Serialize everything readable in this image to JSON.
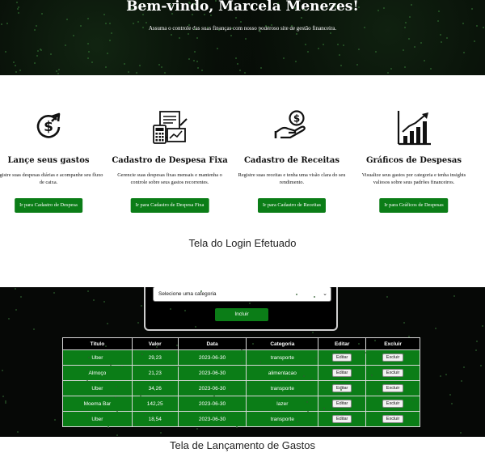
{
  "hero": {
    "title": "Bem-vindo, Marcela Menezes!",
    "subtitle": "Assuma o controle das suas finanças com nosso poderoso site de gestão financeira."
  },
  "cards": [
    {
      "icon": "dollar-growth-icon",
      "title": "Lançe seus gastos",
      "description": "Registre suas despesas diárias e acompanhe seu fluxo de caixa.",
      "button": "Ir para Cadastro de Despesa"
    },
    {
      "icon": "invoice-calculator-icon",
      "title": "Cadastro de Despesa Fixa",
      "description": "Gerencie suas despesas fixas mensais e mantenha o controle sobre seus gastos recorrentes.",
      "button": "Ir para Cadastro de Despesa Fixa"
    },
    {
      "icon": "hand-coin-icon",
      "title": "Cadastro de Receitas",
      "description": "Registre suas receitas e tenha uma visão clara do seu rendimento.",
      "button": "Ir para Cadastro de Receitas"
    },
    {
      "icon": "bar-chart-growth-icon",
      "title": "Gráficos de Despesas",
      "description": "Visualize seus gastos por categoria e tenha insights valiosos sobre seus padrões financeiros.",
      "button": "Ir para Gráficos de Despesas"
    }
  ],
  "caption_login": "Tela do Login Efetuado",
  "form": {
    "category_select": "Selecione uma categoria",
    "submit_label": "Incluir"
  },
  "table": {
    "headers": [
      "Titulo",
      "Valor",
      "Data",
      "Categoria",
      "Editar",
      "Excluir"
    ],
    "edit_label": "Editar",
    "delete_label": "Excluir",
    "rows": [
      [
        "Uber",
        "29,23",
        "2023-06-30",
        "transporte"
      ],
      [
        "Almoço",
        "21,23",
        "2023-06-30",
        "alimentacao"
      ],
      [
        "Uber",
        "34,26",
        "2023-06-30",
        "transporte"
      ],
      [
        "Moema Bar",
        "142,25",
        "2023-06-30",
        "lazer"
      ],
      [
        "Uber",
        "18,54",
        "2023-06-30",
        "transporte"
      ]
    ]
  },
  "caption_gastos": "Tela de Lançamento de Gastos",
  "colors": {
    "accent_green": "#0b7d17",
    "dark_bg": "#060806"
  }
}
